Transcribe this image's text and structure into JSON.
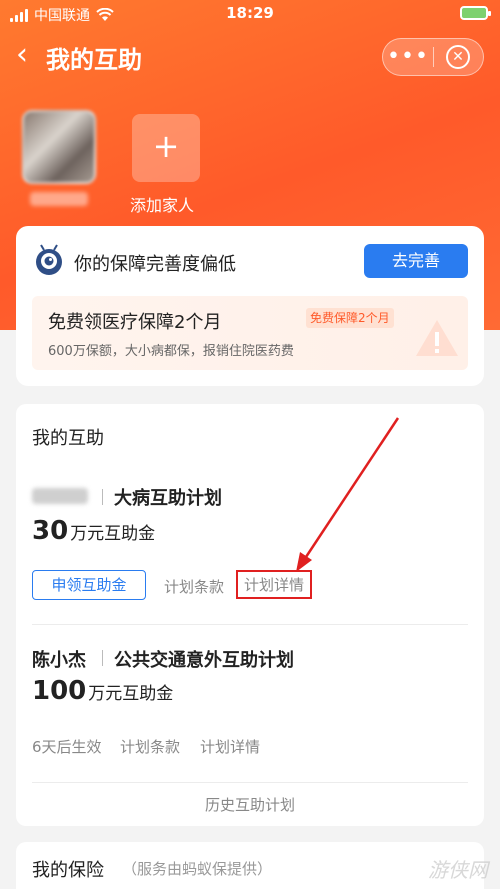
{
  "status_bar": {
    "carrier": "中国联通",
    "time": "18:29"
  },
  "header": {
    "back_glyph": "‹",
    "title": "我的互助",
    "more_glyph": "•••",
    "close_glyph": "✕"
  },
  "family": {
    "add_label": "添加家人",
    "add_glyph": "+"
  },
  "completeness": {
    "title": "你的保障完善度偏低",
    "button": "去完善",
    "promo_title": "免费领医疗保障2个月",
    "promo_badge": "免费保障2个月",
    "promo_subtitle": "600万保额，大小病都保，报销住院医药费"
  },
  "mutual_aid": {
    "heading": "我的互助",
    "plans": [
      {
        "plan_name": "大病互助计划",
        "amount": "30",
        "unit": "万元互助金",
        "apply_button": "申领互助金",
        "terms_link": "计划条款",
        "details_link": "计划详情"
      },
      {
        "member_name": "陈小杰",
        "plan_name": "公共交通意外互助计划",
        "amount": "100",
        "unit": "万元互助金",
        "status": "6天后生效",
        "terms_link": "计划条款",
        "details_link": "计划详情"
      }
    ],
    "history_link": "历史互助计划"
  },
  "insurance": {
    "title": "我的保险",
    "subtitle": "（服务由蚂蚁保提供）"
  },
  "watermark": "游侠网",
  "colors": {
    "brand_orange": "#ff5a2a",
    "primary_blue": "#2a7cf0",
    "highlight_red": "#e02020"
  }
}
